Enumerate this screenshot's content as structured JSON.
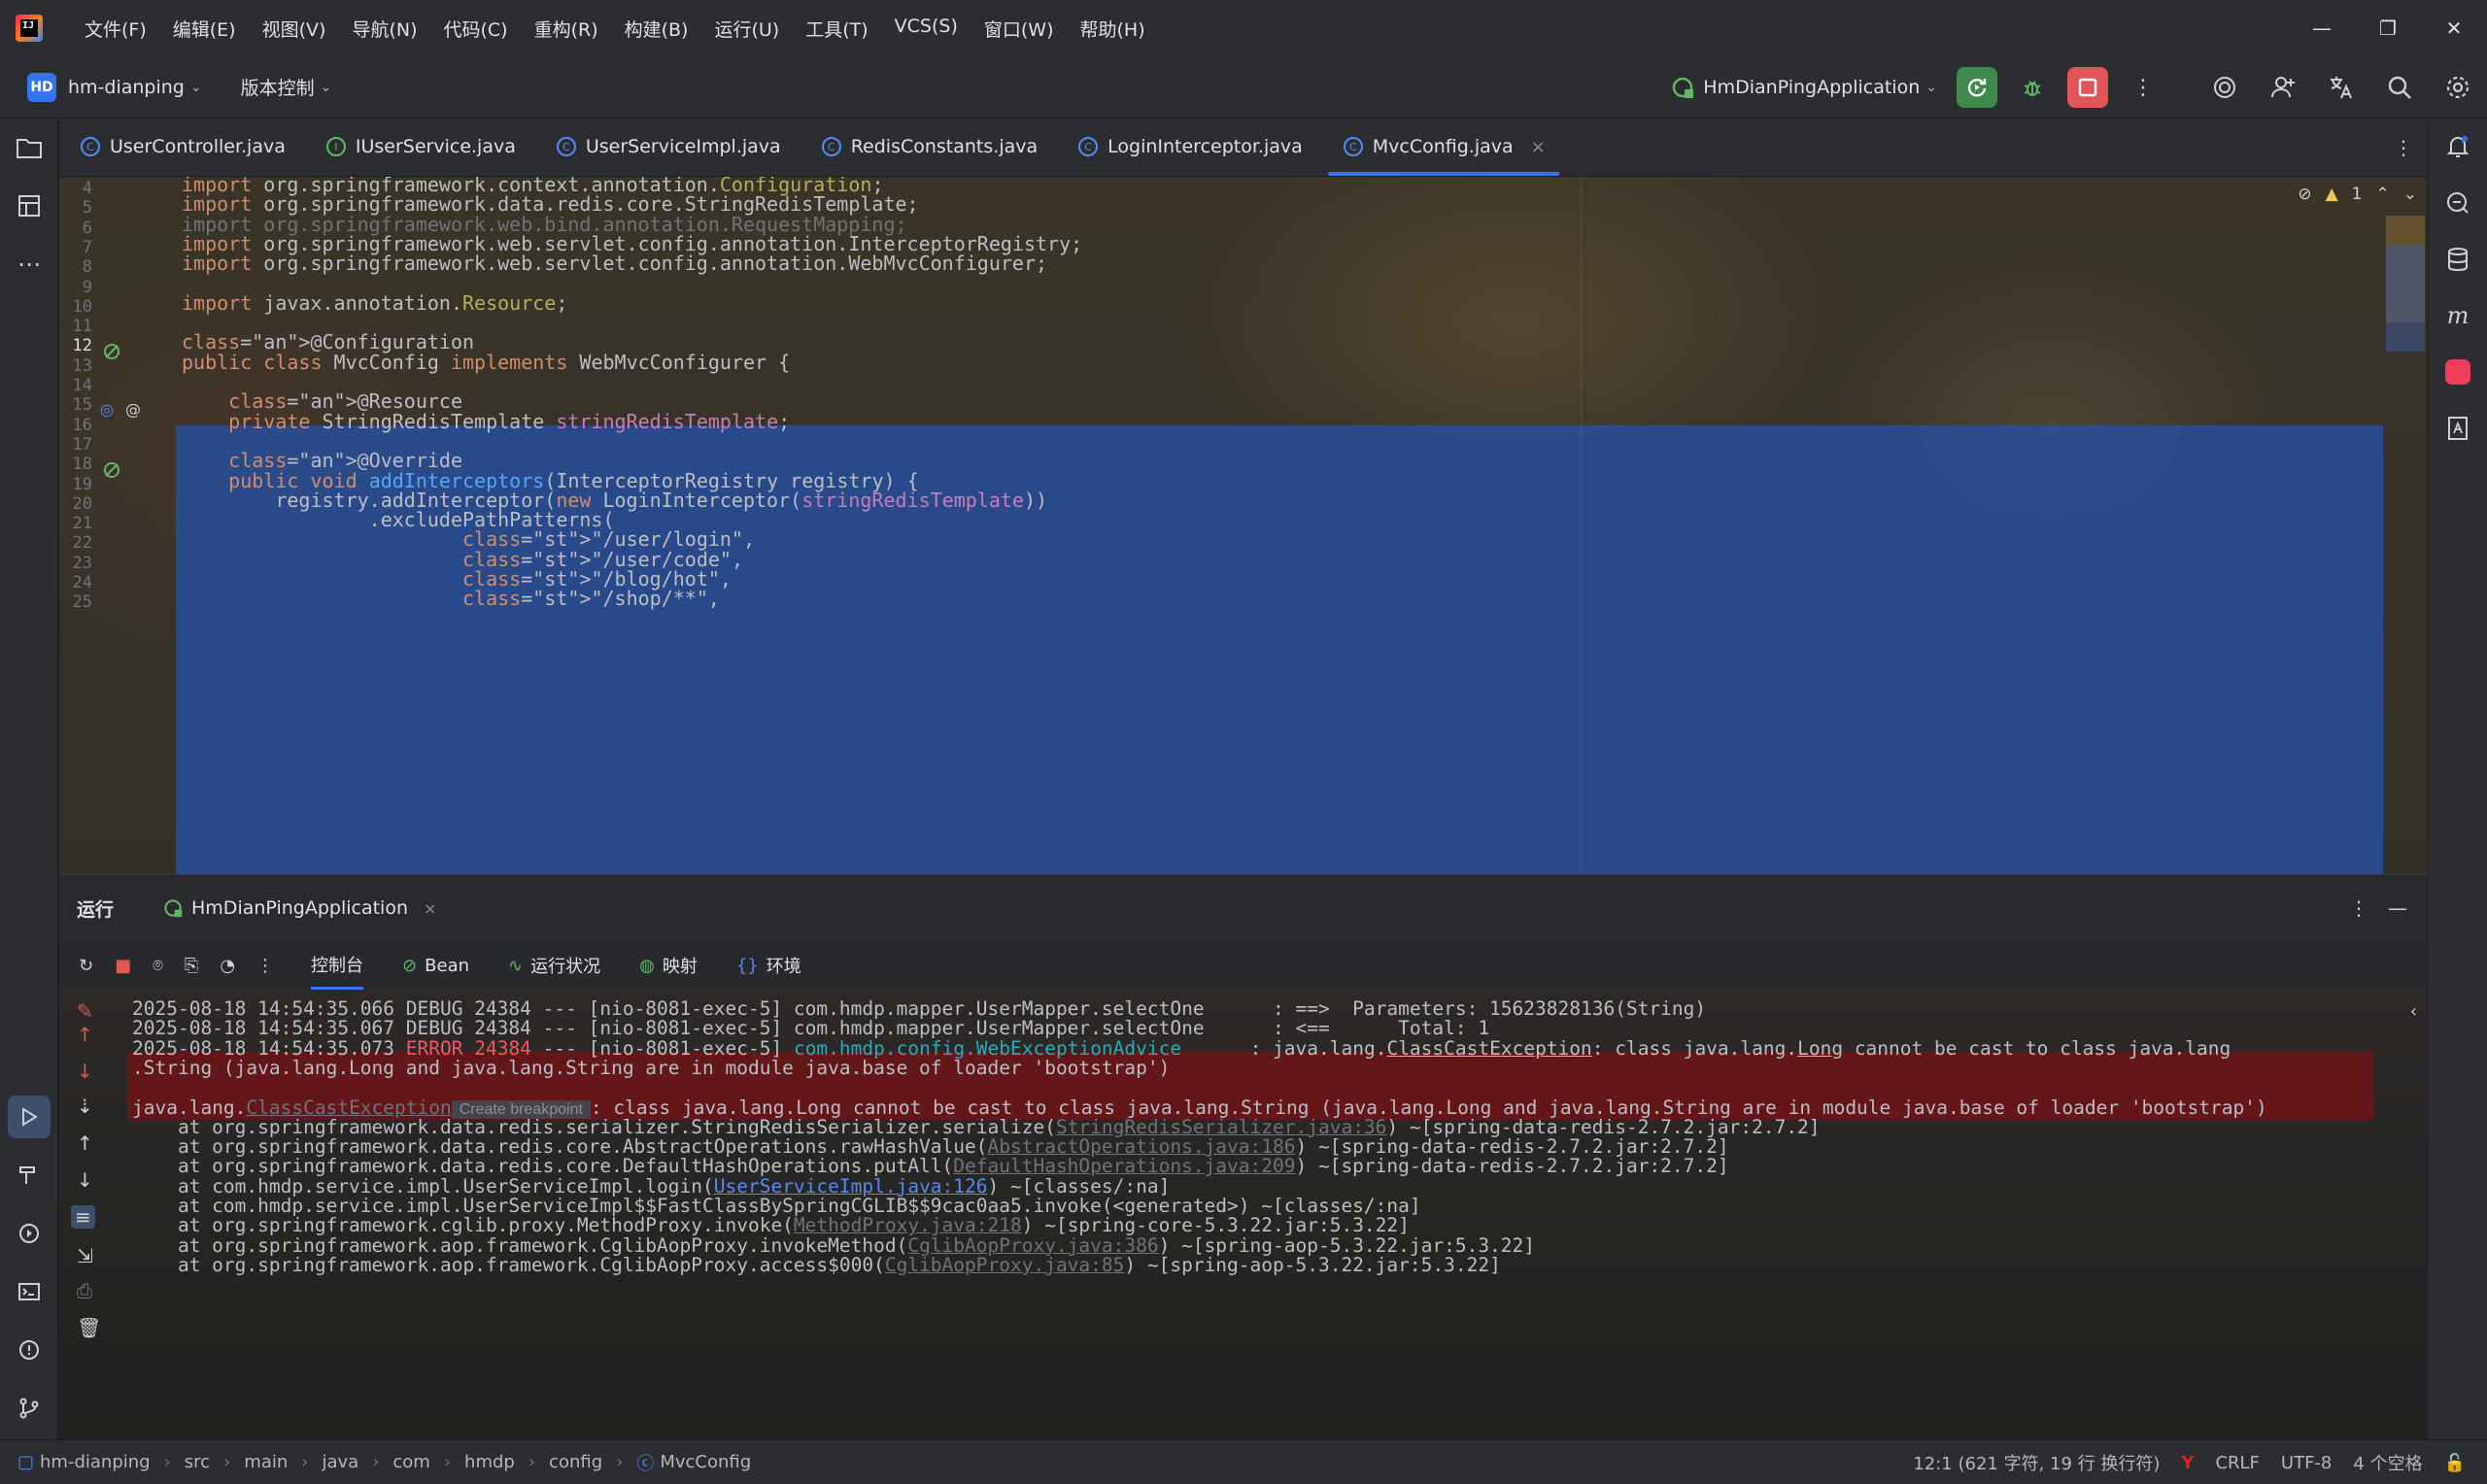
{
  "app": {
    "logo_text": "IJ"
  },
  "menu": [
    "文件(F)",
    "编辑(E)",
    "视图(V)",
    "导航(N)",
    "代码(C)",
    "重构(R)",
    "构建(B)",
    "运行(U)",
    "工具(T)",
    "VCS(S)",
    "窗口(W)",
    "帮助(H)"
  ],
  "window_controls": {
    "minimize": "—",
    "restore": "❐",
    "close": "✕"
  },
  "toolbar": {
    "project_badge": "HD",
    "project_name": "hm-dianping",
    "vcs_label": "版本控制",
    "run_config": "HmDianPingApplication"
  },
  "tabs": [
    {
      "label": "UserController.java",
      "icon": "C",
      "type": "class"
    },
    {
      "label": "IUserService.java",
      "icon": "I",
      "type": "interface"
    },
    {
      "label": "UserServiceImpl.java",
      "icon": "C",
      "type": "class"
    },
    {
      "label": "RedisConstants.java",
      "icon": "C",
      "type": "class"
    },
    {
      "label": "LoginInterceptor.java",
      "icon": "C",
      "type": "class"
    },
    {
      "label": "MvcConfig.java",
      "icon": "C",
      "type": "class",
      "active": true
    }
  ],
  "editor": {
    "inspection": {
      "warnings": "1"
    },
    "line_numbers": [
      "4",
      "5",
      "6",
      "7",
      "8",
      "9",
      "10",
      "11",
      "12",
      "13",
      "14",
      "15",
      "16",
      "17",
      "18",
      "19",
      "20",
      "21",
      "22",
      "23",
      "24",
      "25"
    ],
    "lines": [
      {
        "t": "import org.springframework.context.annotation.",
        "h": "Configuration",
        "e": ";"
      },
      {
        "t": "import org.springframework.data.redis.core.StringRedisTemplate;"
      },
      {
        "t": "import org.springframework.web.bind.annotation.RequestMapping;"
      },
      {
        "t": "import org.springframework.web.servlet.config.annotation.InterceptorRegistry;"
      },
      {
        "t": "import org.springframework.web.servlet.config.annotation.WebMvcConfigurer;"
      },
      {
        "t": ""
      },
      {
        "t": "import javax.annotation.",
        "h": "Resource",
        "e": ";"
      },
      {
        "t": ""
      },
      {
        "t": "@Configuration"
      },
      {
        "t": "public class MvcConfig implements WebMvcConfigurer {"
      },
      {
        "t": ""
      },
      {
        "t": "    @Resource"
      },
      {
        "t": "    private StringRedisTemplate stringRedisTemplate;"
      },
      {
        "t": ""
      },
      {
        "t": "    @Override"
      },
      {
        "t": "    public void addInterceptors(InterceptorRegistry registry) {"
      },
      {
        "t": "        registry.addInterceptor(new LoginInterceptor(stringRedisTemplate))"
      },
      {
        "t": "                .excludePathPatterns("
      },
      {
        "t": "                        \"/user/login\","
      },
      {
        "t": "                        \"/user/code\","
      },
      {
        "t": "                        \"/blog/hot\","
      },
      {
        "t": "                        \"/shop/**\","
      }
    ]
  },
  "run_panel": {
    "title": "运行",
    "config_tab": "HmDianPingApplication",
    "tools": [
      "控制台",
      "Bean",
      "运行状况",
      "映射",
      "环境"
    ],
    "console": {
      "l1": {
        "ts": "2025-08-18 14:54:35.066",
        "lvl": "DEBUG",
        "pid": "24384",
        "sep": "---",
        "thread": "[nio-8081-exec-5]",
        "logger": "com.hmdp.mapper.UserMapper.selectOne",
        "msg": ": ==>  Parameters: 15623828136(String)"
      },
      "l2": {
        "ts": "2025-08-18 14:54:35.067",
        "lvl": "DEBUG",
        "pid": "24384",
        "sep": "---",
        "thread": "[nio-8081-exec-5]",
        "logger": "com.hmdp.mapper.UserMapper.selectOne",
        "msg": ": <==      Total: 1"
      },
      "err": {
        "ts": "2025-08-18 14:54:35.073",
        "lvl": "ERROR",
        "pid": "24384",
        "sep": "---",
        "thread": "[nio-8081-exec-5]",
        "logger": "com.hmdp.config.WebExceptionAdvice",
        "msg": ": java.lang.ClassCastException: class java.lang.Long cannot be cast to class java.lang",
        "msg2": ".String (java.lang.Long and java.lang.String are in module java.base of loader 'bootstrap')"
      },
      "exc": {
        "prefix": "java.lang.",
        "name": "ClassCastException",
        "tooltip": "Create breakpoint",
        "rest": ": class java.lang.Long cannot be cast to class java.lang.String (java.lang.Long and java.lang.String are in module java.base of loader 'bootstrap')"
      },
      "stack": [
        {
          "a": "    at org.springframework.data.redis.serializer.StringRedisSerializer.serialize(",
          "f": "StringRedisSerializer.java:36",
          "b": ") ~[spring-data-redis-2.7.2.jar:2.7.2]",
          "own": false
        },
        {
          "a": "    at org.springframework.data.redis.core.AbstractOperations.rawHashValue(",
          "f": "AbstractOperations.java:186",
          "b": ") ~[spring-data-redis-2.7.2.jar:2.7.2]",
          "own": false
        },
        {
          "a": "    at org.springframework.data.redis.core.DefaultHashOperations.putAll(",
          "f": "DefaultHashOperations.java:209",
          "b": ") ~[spring-data-redis-2.7.2.jar:2.7.2]",
          "own": false
        },
        {
          "a": "    at com.hmdp.service.impl.UserServiceImpl.login(",
          "f": "UserServiceImpl.java:126",
          "b": ") ~[classes/:na]",
          "own": true
        },
        {
          "a": "    at com.hmdp.service.impl.UserServiceImpl$$FastClassBySpringCGLIB$$9cac0aa5.invoke(<generated>) ~[classes/:na]",
          "f": "",
          "b": "",
          "own": false
        },
        {
          "a": "    at org.springframework.cglib.proxy.MethodProxy.invoke(",
          "f": "MethodProxy.java:218",
          "b": ") ~[spring-core-5.3.22.jar:5.3.22]",
          "own": false
        },
        {
          "a": "    at org.springframework.aop.framework.CglibAopProxy.invokeMethod(",
          "f": "CglibAopProxy.java:386",
          "b": ") ~[spring-aop-5.3.22.jar:5.3.22]",
          "own": false
        },
        {
          "a": "    at org.springframework.aop.framework.CglibAopProxy.access$000(",
          "f": "CglibAopProxy.java:85",
          "b": ") ~[spring-aop-5.3.22.jar:5.3.22]",
          "own": false
        }
      ]
    }
  },
  "statusbar": {
    "breadcrumbs": [
      "hm-dianping",
      "src",
      "main",
      "java",
      "com",
      "hmdp",
      "config",
      "MvcConfig"
    ],
    "position": "12:1 (621 字符, 19 行 换行符)",
    "line_sep": "CRLF",
    "encoding": "UTF-8",
    "indent": "4 个空格"
  },
  "colors": {
    "accent": "#3574f0",
    "error": "#f75464",
    "selection": "#264fa0",
    "run_green": "#5fb865",
    "stop_red": "#e05555"
  }
}
